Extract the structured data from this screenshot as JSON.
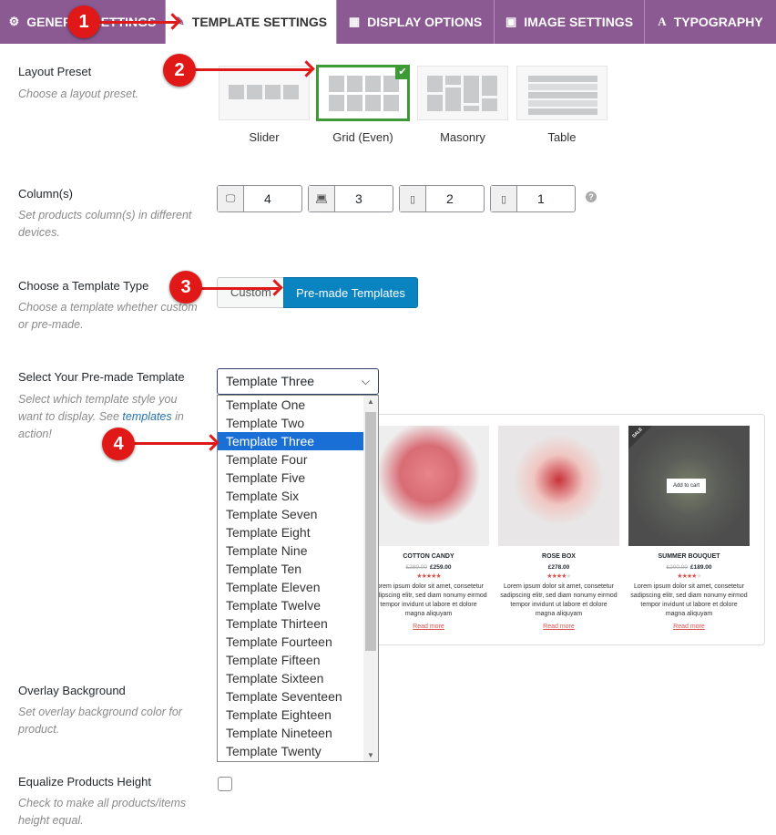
{
  "tabs": [
    {
      "label": "GENERAL SETTINGS",
      "icon": "gear-icon"
    },
    {
      "label": "TEMPLATE SETTINGS",
      "icon": "template-icon",
      "active": true
    },
    {
      "label": "DISPLAY OPTIONS",
      "icon": "grid-icon"
    },
    {
      "label": "IMAGE SETTINGS",
      "icon": "image-icon"
    },
    {
      "label": "TYPOGRAPHY",
      "icon": "font-icon"
    }
  ],
  "layout_preset": {
    "label": "Layout Preset",
    "desc": "Choose a layout preset.",
    "options": [
      "Slider",
      "Grid (Even)",
      "Masonry",
      "Table"
    ],
    "selected": "Grid (Even)"
  },
  "columns": {
    "label": "Column(s)",
    "desc": "Set products column(s) in different devices.",
    "values": {
      "desktop": "4",
      "laptop": "3",
      "tablet": "2",
      "mobile": "1"
    }
  },
  "template_type": {
    "label": "Choose a Template Type",
    "desc": "Choose a template whether custom or pre-made.",
    "custom": "Custom",
    "premade": "Pre-made Templates",
    "selected": "Pre-made Templates"
  },
  "premade": {
    "label": "Select Your Pre-made Template",
    "desc_a": "Select which template style you want to display. See ",
    "link": "templates",
    "desc_b": " in action!",
    "selected": "Template Three",
    "options": [
      "Template One",
      "Template Two",
      "Template Three",
      "Template Four",
      "Template Five",
      "Template Six",
      "Template Seven",
      "Template Eight",
      "Template Nine",
      "Template Ten",
      "Template Eleven",
      "Template Twelve",
      "Template Thirteen",
      "Template Fourteen",
      "Template Fifteen",
      "Template Sixteen",
      "Template Seventeen",
      "Template Eighteen",
      "Template Nineteen",
      "Template Twenty"
    ]
  },
  "preview": {
    "products": [
      {
        "title": "COTTON CANDY",
        "old": "£289.00",
        "price": "£259.00",
        "rating": 5,
        "desc": "Lorem ipsum dolor sit amet, consetetur sadipscing elitr, sed diam nonumy eirmod tempor invidunt ut labore et dolore magna aliquyam",
        "more": "Read more"
      },
      {
        "title": "ROSE BOX",
        "old": "",
        "price": "£278.00",
        "rating": 4,
        "desc": "Lorem ipsum dolor sit amet, consetetur sadipscing elitr, sed diam nonumy eirmod tempor invidunt ut labore et dolore magna aliquyam",
        "more": "Read more"
      },
      {
        "title": "SUMMER BOUQUET",
        "old": "£200.00",
        "price": "£189.00",
        "rating": 4,
        "desc": "Lorem ipsum dolor sit amet, consetetur sadipscing elitr, sed diam nonumy eirmod tempor invidunt ut labore et dolore magna aliquyam",
        "more": "Read more",
        "sale": "SALE",
        "cart": "Add to cart"
      }
    ]
  },
  "overlay": {
    "label": "Overlay Background",
    "desc": "Set overlay background color for product."
  },
  "equalize": {
    "label": "Equalize Products Height",
    "desc": "Check to make all products/items height equal.",
    "checked": false
  },
  "annotations": [
    "1",
    "2",
    "3",
    "4"
  ],
  "colors": {
    "tab_bar": "#8c5a92",
    "primary": "#0a84c1",
    "selected_preset": "#3d9a37",
    "annotation": "#e01818",
    "highlight": "#1a6fd6"
  }
}
